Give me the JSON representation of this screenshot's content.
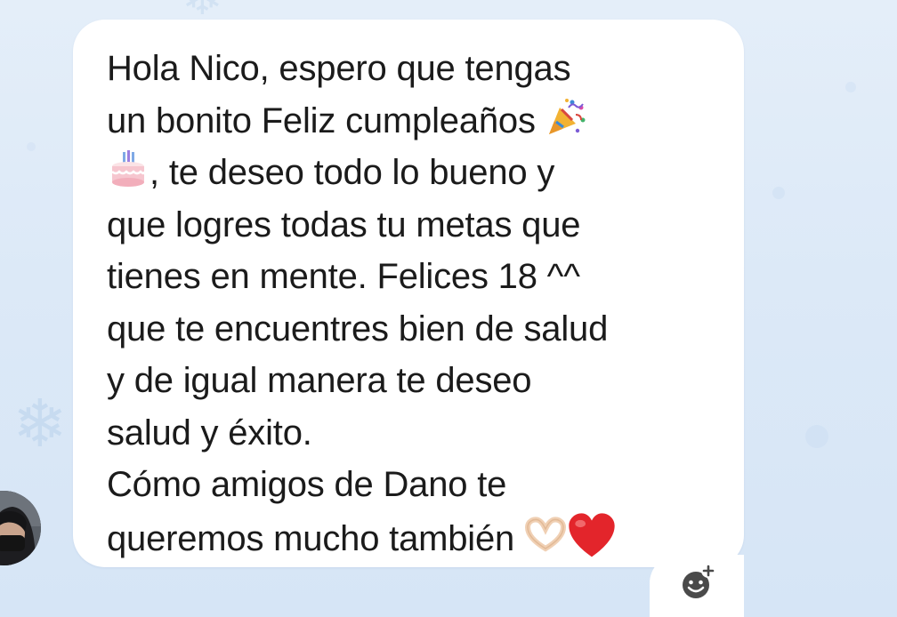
{
  "message": {
    "lines": [
      "Hola Nico, espero que tengas",
      "un bonito Feliz cumpleaños",
      ", te deseo todo lo bueno y",
      "que logres todas tu metas que",
      "tienes en mente. Felices 18 ^^",
      "que te encuentres bien de salud",
      "y de igual manera te deseo",
      "salud y éxito.",
      "Cómo amigos de Dano te",
      "queremos mucho también"
    ],
    "emojis": {
      "line2_end": "party-popper",
      "line3_start": "birthday-cake",
      "line10_end_1": "heart-hands",
      "line10_end_2": "red-heart"
    }
  },
  "avatar": {
    "icon": "profile-photo"
  },
  "reaction": {
    "icon": "add-reaction-icon"
  },
  "colors": {
    "background": "#dce9f7",
    "bubble": "#ffffff",
    "text": "#1b1b1b",
    "heart": "#e3252b",
    "snowflake": "#c7dbf0"
  }
}
